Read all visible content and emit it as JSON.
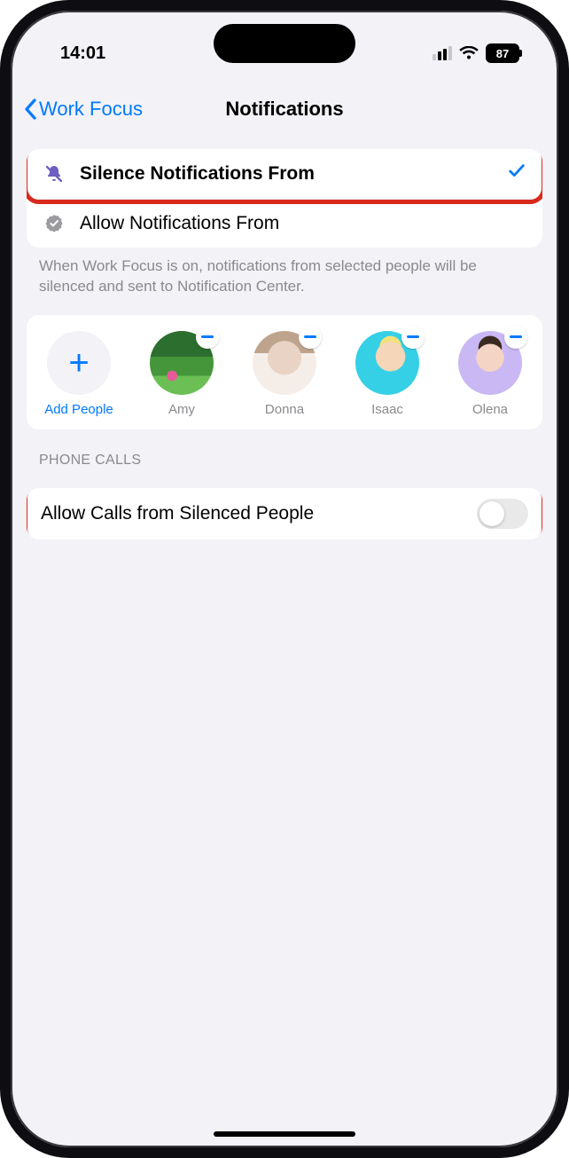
{
  "status": {
    "time": "14:01",
    "battery": "87"
  },
  "nav": {
    "back": "Work Focus",
    "title": "Notifications"
  },
  "options": {
    "silence": {
      "label": "Silence Notifications From",
      "selected": true
    },
    "allow": {
      "label": "Allow Notifications From",
      "selected": false
    }
  },
  "footnote": "When Work Focus is on, notifications from selected people will be silenced and sent to Notification Center.",
  "people": {
    "add_label": "Add People",
    "items": [
      {
        "name": "Amy"
      },
      {
        "name": "Donna"
      },
      {
        "name": "Isaac"
      },
      {
        "name": "Olena"
      }
    ]
  },
  "phone_calls": {
    "header": "PHONE CALLS",
    "allow_calls_label": "Allow Calls from Silenced People",
    "allow_calls_value": false
  },
  "icons": {
    "bell_slash": "bell-slash-icon",
    "check_seal": "check-seal-icon"
  },
  "colors": {
    "accent": "#007aff",
    "highlight": "#d9291c"
  }
}
